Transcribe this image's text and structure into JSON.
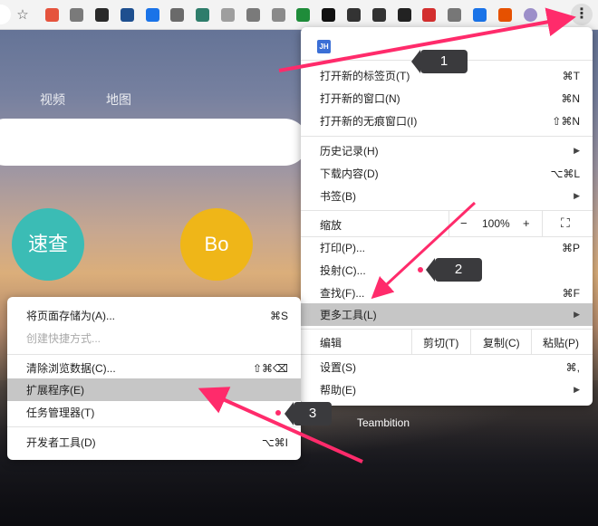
{
  "toolbar": {
    "bookmark_icon": "star-icon",
    "extensions": [
      {
        "name": "ext-1-icon",
        "color": "#e5533d"
      },
      {
        "name": "ext-2-icon",
        "color": "#7a7a7a"
      },
      {
        "name": "ext-3-icon",
        "color": "#2a2a2a"
      },
      {
        "name": "ext-4-icon",
        "color": "#1e4f8f"
      },
      {
        "name": "ext-5-icon",
        "color": "#1a73e8"
      },
      {
        "name": "ext-6-icon",
        "color": "#6a6a6a"
      },
      {
        "name": "ext-7-icon",
        "color": "#2e7d6b"
      },
      {
        "name": "ext-8-icon",
        "color": "#9e9e9e"
      },
      {
        "name": "ext-9-icon",
        "color": "#7a7a7a"
      },
      {
        "name": "ext-10-icon",
        "color": "#8a8a8a"
      },
      {
        "name": "ext-11-icon",
        "color": "#1f8c3a"
      },
      {
        "name": "ext-12-icon",
        "color": "#111111"
      },
      {
        "name": "ext-13-icon",
        "color": "#333333"
      },
      {
        "name": "ext-14-icon",
        "color": "#333333"
      },
      {
        "name": "ext-15-icon",
        "color": "#222222"
      },
      {
        "name": "ext-16-icon",
        "color": "#d32f2f"
      },
      {
        "name": "ext-17-icon",
        "color": "#777777"
      },
      {
        "name": "ext-18-icon",
        "color": "#1a73e8"
      },
      {
        "name": "ext-19-icon",
        "color": "#e65100"
      },
      {
        "name": "profile-avatar-icon",
        "color": "#9c8fc9"
      }
    ]
  },
  "page": {
    "nav_video": "视频",
    "nav_map": "地图",
    "tile_1_text": "速查",
    "tile_1_color": "#3bbcb5",
    "tile_2_text": "Bo",
    "tile_2_color": "#efb618",
    "tile_3_label": "Teambition"
  },
  "menu": {
    "profile_badge": "JH",
    "new_tab": "打开新的标签页(T)",
    "new_tab_sc": "⌘T",
    "new_window": "打开新的窗口(N)",
    "new_window_sc": "⌘N",
    "incognito": "打开新的无痕窗口(I)",
    "incognito_sc": "⇧⌘N",
    "history": "历史记录(H)",
    "downloads": "下载内容(D)",
    "downloads_sc": "⌥⌘L",
    "bookmarks": "书签(B)",
    "zoom_label": "缩放",
    "zoom_minus": "−",
    "zoom_value": "100%",
    "zoom_plus": "+",
    "print": "打印(P)...",
    "print_sc": "⌘P",
    "cast": "投射(C)...",
    "find": "查找(F)...",
    "find_sc": "⌘F",
    "more_tools": "更多工具(L)",
    "edit_label": "编辑",
    "cut": "剪切(T)",
    "copy": "复制(C)",
    "paste": "粘贴(P)",
    "settings": "设置(S)",
    "settings_sc": "⌘,",
    "help": "帮助(E)"
  },
  "submenu": {
    "save_page": "将页面存储为(A)...",
    "save_page_sc": "⌘S",
    "create_shortcut": "创建快捷方式...",
    "clear_data": "清除浏览数据(C)...",
    "clear_data_sc": "⇧⌘⌫",
    "extensions": "扩展程序(E)",
    "task_manager": "任务管理器(T)",
    "dev_tools": "开发者工具(D)",
    "dev_tools_sc": "⌥⌘I"
  },
  "annotations": {
    "step_1": "1",
    "step_2": "2",
    "step_3": "3",
    "accent_color": "#ff2b6b"
  }
}
